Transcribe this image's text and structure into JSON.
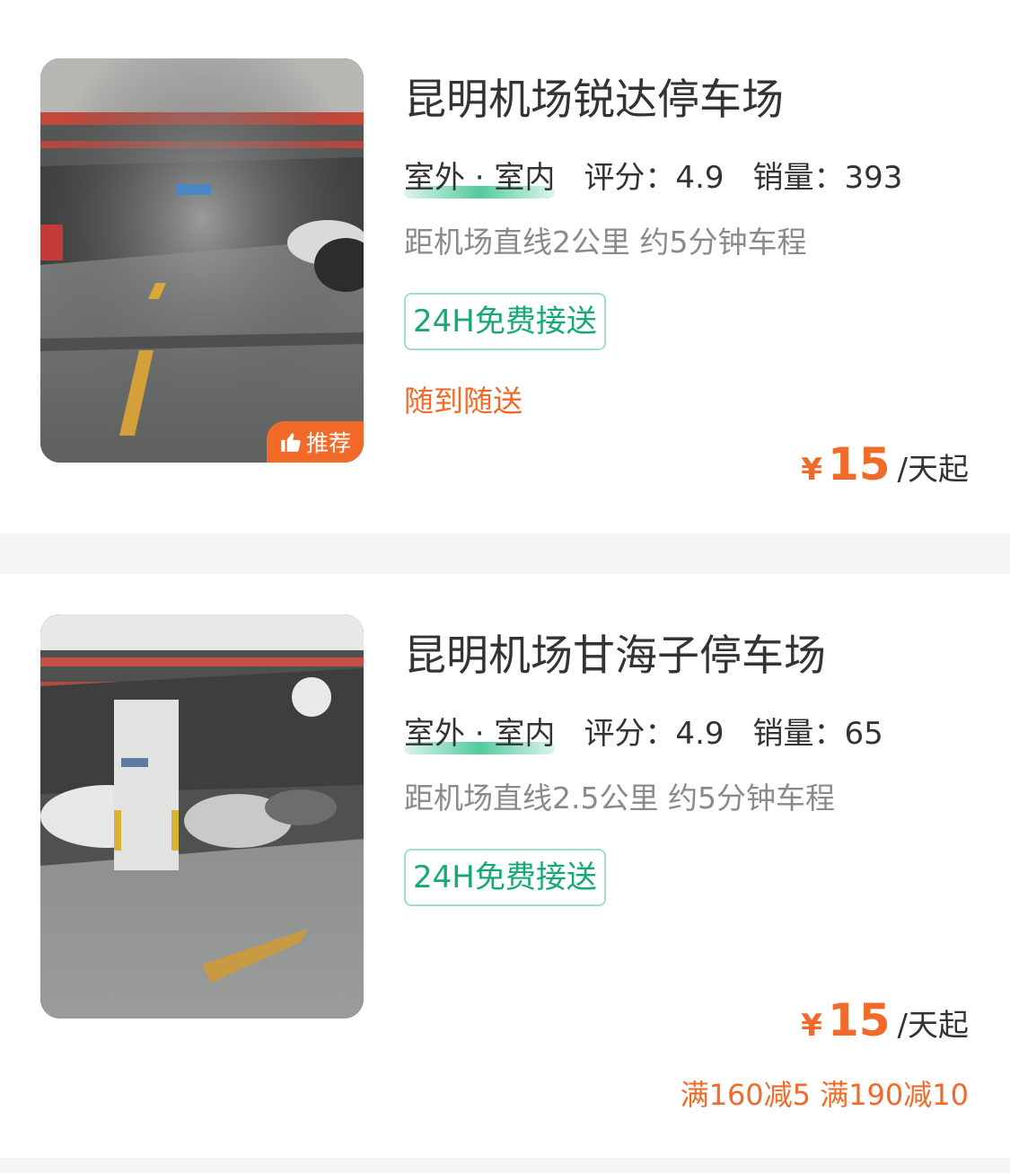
{
  "lots": [
    {
      "name": "昆明机场锐达停车场",
      "type_tag": "室外 · 室内",
      "rating": "评分：4.9",
      "sales": "销量：393",
      "distance": "距机场直线2公里 约5分钟车程",
      "service_tag": "24H免费接送",
      "feature": "随到随送",
      "badge": "推荐",
      "price_currency": "¥",
      "price_value": "15",
      "price_unit": "/天起"
    },
    {
      "name": "昆明机场甘海子停车场",
      "type_tag": "室外 · 室内",
      "rating": "评分：4.9",
      "sales": "销量：65",
      "distance": "距机场直线2.5公里 约5分钟车程",
      "service_tag": "24H免费接送",
      "price_currency": "¥",
      "price_value": "15",
      "price_unit": "/天起",
      "discount": "满160减5 满190减10"
    }
  ],
  "colors": {
    "accent_orange": "#f26a2a",
    "accent_green": "#17a878",
    "tag_border_green": "#9fe0c6",
    "divider_gray": "#f5f5f5"
  },
  "icons": {
    "badge_icon": "thumbs-up-icon"
  }
}
